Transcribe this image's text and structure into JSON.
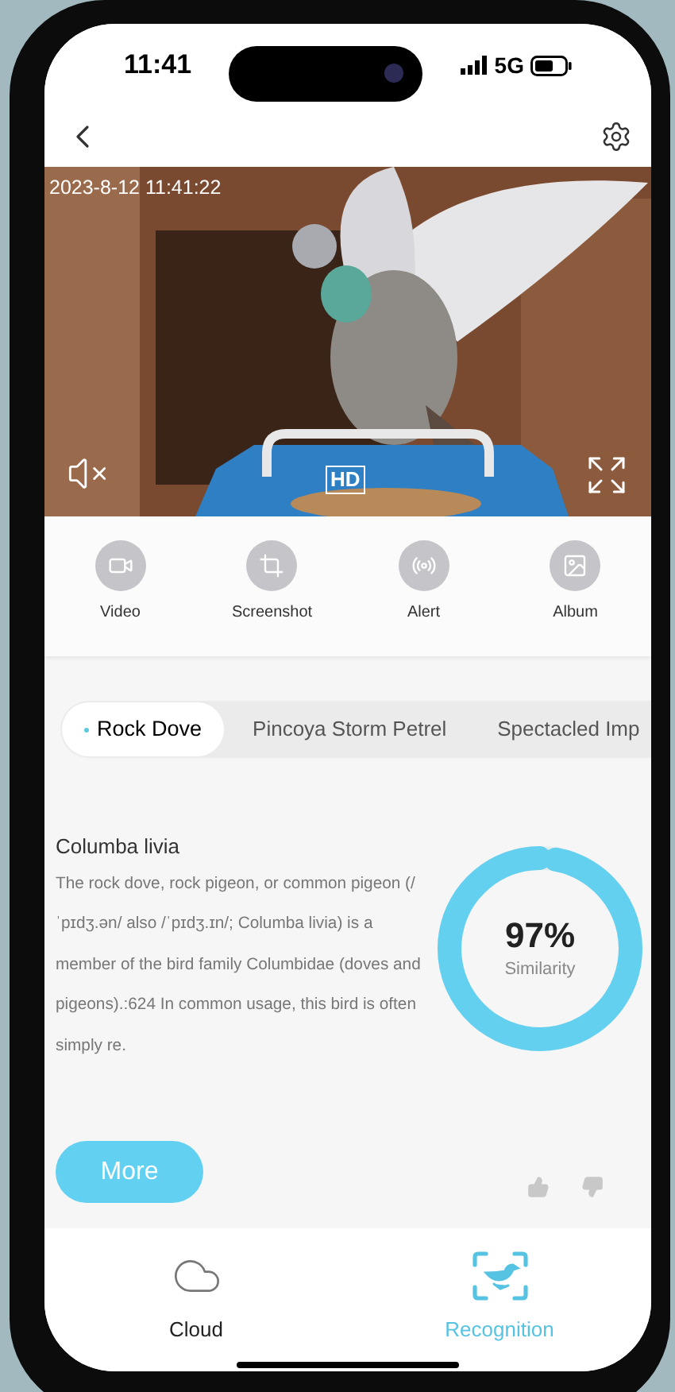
{
  "status_bar": {
    "time": "11:41",
    "network": "5G"
  },
  "video": {
    "timestamp": "2023-8-12 11:41:22",
    "quality": "HD",
    "muted": true
  },
  "actions": [
    {
      "kind": "video",
      "label": "Video"
    },
    {
      "kind": "screenshot",
      "label": "Screenshot"
    },
    {
      "kind": "alert",
      "label": "Alert"
    },
    {
      "kind": "album",
      "label": "Album"
    }
  ],
  "tabs": [
    {
      "label": "Rock Dove",
      "selected": true
    },
    {
      "label": "Pincoya Storm Petrel",
      "selected": false
    },
    {
      "label": "Spectacled Imp",
      "selected": false
    }
  ],
  "result": {
    "title": "Columba livia",
    "description": "The rock dove, rock pigeon, or common pigeon (/ˈpɪdʒ.ən/ also /ˈpɪdʒ.ɪn/; Columba livia) is a member of the bird family Columbidae (doves and pigeons).:624 In common usage, this bird is often simply re.",
    "similarity": {
      "reading": "97%",
      "label": "Similarity",
      "level": 0.97
    },
    "more_button": "More"
  },
  "bottom_nav": [
    {
      "kind": "cloud",
      "label": "Cloud",
      "selected": false
    },
    {
      "kind": "recognition",
      "label": "Recognition",
      "selected": true
    }
  ]
}
